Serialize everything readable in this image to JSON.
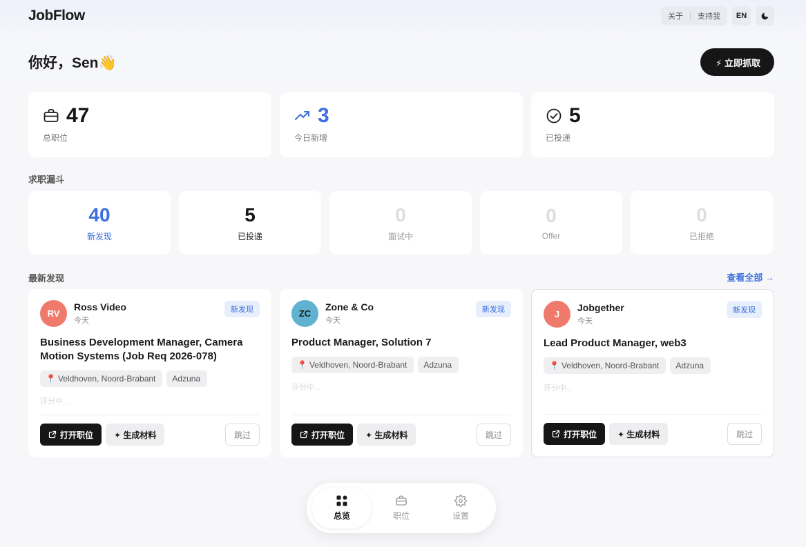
{
  "header": {
    "logo": "JobFlow",
    "links": [
      "关于",
      "支持我"
    ],
    "lang_button": "EN",
    "theme_icon": "moon-icon"
  },
  "greeting": {
    "text": "你好，Sen",
    "emoji": "👋",
    "fetch_button": "⚡ 立即抓取"
  },
  "stats": [
    {
      "icon": "briefcase-icon",
      "value": "47",
      "label": "总职位"
    },
    {
      "icon": "trending-up-icon",
      "value": "3",
      "label": "今日新增"
    },
    {
      "icon": "check-circle-icon",
      "value": "5",
      "label": "已投递"
    }
  ],
  "funnel": {
    "title": "求职漏斗",
    "stages": [
      {
        "value": "40",
        "label": "新发现"
      },
      {
        "value": "5",
        "label": "已投递"
      },
      {
        "value": "0",
        "label": "面试中"
      },
      {
        "value": "0",
        "label": "Offer"
      },
      {
        "value": "0",
        "label": "已拒绝"
      }
    ]
  },
  "recent": {
    "title": "最新发现",
    "view_all": "查看全部 →",
    "jobs": [
      {
        "initials": "RV",
        "avatar_color": "#ef7a6c",
        "company": "Ross Video",
        "posted": "今天",
        "badge": "新发现",
        "title": "Business Development Manager, Camera Motion Systems (Job Req 2026-078)",
        "location": "Veldhoven, Noord-Brabant",
        "source": "Adzuna",
        "score_text": "评分中...",
        "open_label": "打开职位",
        "generate_label": "✦ 生成材料",
        "skip_label": "跳过"
      },
      {
        "initials": "ZC",
        "avatar_color": "#5fb3d1",
        "company": "Zone & Co",
        "posted": "今天",
        "badge": "新发现",
        "title": "Product Manager, Solution 7",
        "location": "Veldhoven, Noord-Brabant",
        "source": "Adzuna",
        "score_text": "评分中...",
        "open_label": "打开职位",
        "generate_label": "✦ 生成材料",
        "skip_label": "跳过"
      },
      {
        "initials": "J",
        "avatar_color": "#ef7a6c",
        "company": "Jobgether",
        "posted": "今天",
        "badge": "新发现",
        "title": "Lead Product Manager, web3",
        "location": "Veldhoven, Noord-Brabant",
        "source": "Adzuna",
        "score_text": "评分中...",
        "open_label": "打开职位",
        "generate_label": "✦ 生成材料",
        "skip_label": "跳过"
      }
    ]
  },
  "nav": [
    {
      "icon": "grid-icon",
      "label": "总览",
      "active": true
    },
    {
      "icon": "briefcase-icon",
      "label": "职位",
      "active": false
    },
    {
      "icon": "gear-icon",
      "label": "设置",
      "active": false
    }
  ]
}
